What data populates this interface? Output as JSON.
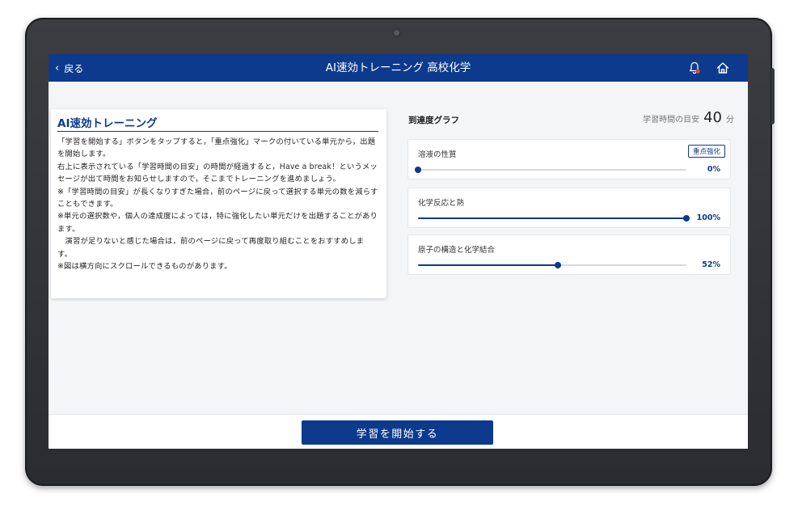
{
  "header": {
    "back_label": "戻る",
    "title": "AI速効トレーニング 高校化学"
  },
  "info": {
    "title": "AI速効トレーニング",
    "paragraphs": [
      "「学習を開始する」ボタンをタップすると，「重点強化」マークの付いている単元から，出題を開始します。",
      "右上に表示されている「学習時間の目安」の時間が経過すると，Have a break！というメッセージが出て時間をお知らせしますので，そこまでトレーニングを進めましょう。",
      "※「学習時間の目安」が長くなりすぎた場合，前のページに戻って選択する単元の数を減らすこともできます。",
      "※単元の選択数や，個人の達成度によっては，特に強化したい単元だけを出題することがあります。",
      "　演習が足りないと感じた場合は，前のページに戻って再度取り組むことをおすすめします。",
      "※図は横方向にスクロールできるものがあります。"
    ]
  },
  "graph": {
    "title": "到達度グラフ",
    "target_label": "学習時間の目安",
    "target_value": "40",
    "target_unit": "分"
  },
  "units": [
    {
      "name": "溶液の性質",
      "badge": "重点強化",
      "percent": 0,
      "percent_label": "0%"
    },
    {
      "name": "化学反応と熱",
      "badge": "",
      "percent": 100,
      "percent_label": "100%"
    },
    {
      "name": "原子の構造と化学結合",
      "badge": "",
      "percent": 52,
      "percent_label": "52%"
    }
  ],
  "footer": {
    "start_label": "学習を開始する"
  },
  "colors": {
    "accent": "#0d3a8c",
    "notification": "#e8452c"
  },
  "icons": [
    "chevron-left-icon",
    "bell-icon",
    "home-icon"
  ]
}
